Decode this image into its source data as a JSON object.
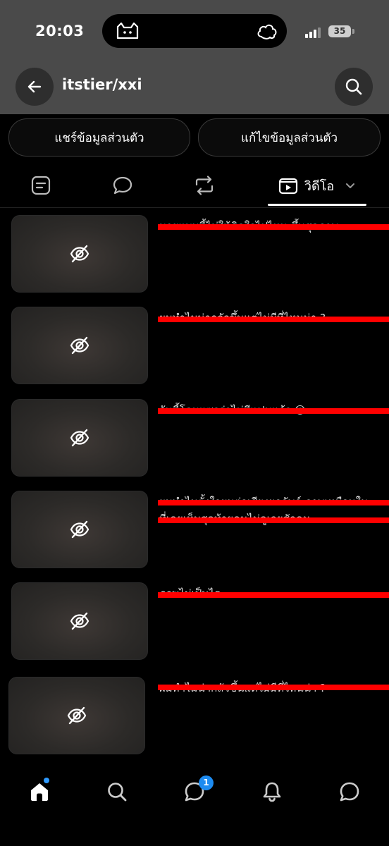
{
  "status_bar": {
    "time": "20:03",
    "battery": "35"
  },
  "header": {
    "title": "itstier/xxi"
  },
  "actions": {
    "share_label": "แชร์ข้อมูลส่วนตัว",
    "edit_label": "แก้ไขข้อมูลส่วนตัว"
  },
  "tabs": {
    "active_label": "วิดีโอ"
  },
  "videos": [
    {
      "text": "นายแบบนี้ไม่ให้คิดใจไปไหน ขึ้นสุดภาพ..."
    },
    {
      "text": "ผมทำไมน่ากลัวขึ้นแต่ไม่มีที่ไหนน่า ?"
    },
    {
      "text": "วันนี้โดนแซวว่าไม่มีแฟนแล้ว 😢"
    },
    {
      "text": "ผมทำไมตั้งใจผมต่อเสียงผลลัพธ์ ภาพเหมือนใน",
      "text2": "ที่เคยเห็นสุดท้ายคนไม่ดูเลยสักคน"
    },
    {
      "text": "ภาพไม่เป็นไร"
    },
    {
      "text": "ผมทำไมน่ากลัวขึ้นแต่ไม่มีที่ไหนน่า ?"
    }
  ],
  "nav": {
    "notification_badge": "1"
  },
  "colors": {
    "accent": "#1d8bf0",
    "redact": "#ff0000",
    "header_bg": "#4a4a4a"
  }
}
